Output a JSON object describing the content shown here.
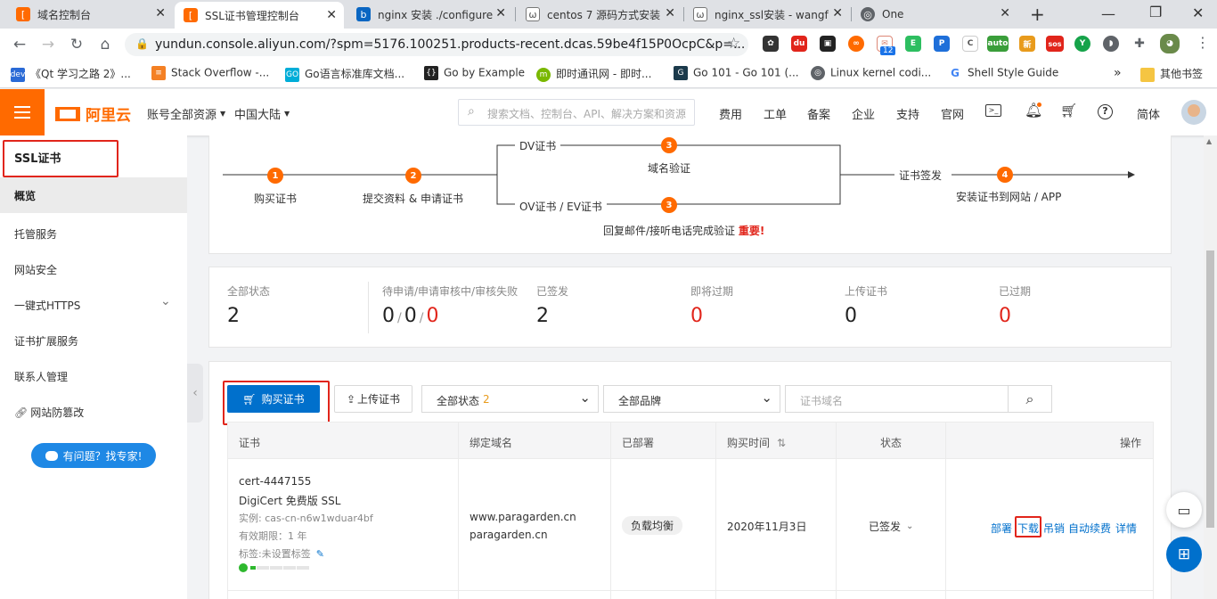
{
  "browser": {
    "tabs": [
      {
        "title": "域名控制台",
        "favicon": "aliyun-icon",
        "active": false
      },
      {
        "title": "SSL证书管理控制台",
        "favicon": "aliyun-icon",
        "active": true
      },
      {
        "title": "nginx 安装 ./configure",
        "favicon": "bing-icon",
        "active": false
      },
      {
        "title": "centos 7 源码方式安装",
        "favicon": "blog-icon",
        "active": false
      },
      {
        "title": "nginx_ssl安装 - wangf",
        "favicon": "blog-icon",
        "active": false
      },
      {
        "title": "One",
        "favicon": "globe-icon",
        "active": false
      }
    ],
    "url": "yundun.console.aliyun.com/?spm=5176.100251.products-recent.dcas.59be4f15P0OcpC&p=...",
    "extension_badges": {
      "mail": "12",
      "auto": "auto",
      "new": "新",
      "sos": "sos"
    },
    "bookmarks": [
      "《Qt 学习之路 2》...",
      "Stack Overflow -...",
      "Go语言标准库文档...",
      "Go by Example",
      "即时通讯网 - 即时...",
      "Go 101 - Go 101 (...",
      "Linux kernel codi...",
      "Shell Style Guide"
    ],
    "bookmarks_more": "»",
    "other_bookmarks": "其他书签"
  },
  "header": {
    "logo": "阿里云",
    "account_scope": "账号全部资源",
    "region": "中国大陆",
    "search_placeholder": "搜索文档、控制台、API、解决方案和资源",
    "nav": [
      "费用",
      "工单",
      "备案",
      "企业",
      "支持",
      "官网"
    ],
    "language": "简体"
  },
  "sidebar": {
    "title": "SSL证书",
    "items": [
      "概览",
      "托管服务",
      "网站安全",
      "一键式HTTPS",
      "证书扩展服务",
      "联系人管理",
      "网站防篡改"
    ],
    "help_button": "有问题？找专家!"
  },
  "flow": {
    "steps": [
      {
        "num": "1",
        "label": "购买证书"
      },
      {
        "num": "2",
        "label": "提交资料 & 申请证书"
      },
      {
        "num": "3",
        "label": "域名验证"
      },
      {
        "num": "3",
        "label": "回复邮件/接听电话完成验证"
      },
      {
        "num": "4",
        "label": "安装证书到网站 / APP"
      }
    ],
    "dv_label": "DV证书",
    "ov_label": "OV证书 / EV证书",
    "issue_label": "证书签发",
    "important": "重要!"
  },
  "stats": {
    "all": {
      "label": "全部状态",
      "value": "2"
    },
    "pending": {
      "label": "待申请/申请审核中/审核失败",
      "v1": "0",
      "v2": "0",
      "v3": "0",
      "sep": "/"
    },
    "issued": {
      "label": "已签发",
      "value": "2"
    },
    "expiring": {
      "label": "即将过期",
      "value": "0"
    },
    "uploaded": {
      "label": "上传证书",
      "value": "0"
    },
    "expired": {
      "label": "已过期",
      "value": "0"
    }
  },
  "toolbar": {
    "buy": "购买证书",
    "upload": "上传证书",
    "status_filter": "全部状态",
    "status_count": "2",
    "brand_filter": "全部品牌",
    "domain_placeholder": "证书域名"
  },
  "table": {
    "headers": [
      "证书",
      "绑定域名",
      "已部署",
      "购买时间",
      "状态",
      "操作"
    ],
    "rows": [
      {
        "name": "cert-4447155",
        "product": "DigiCert 免费版 SSL",
        "instance": "实例: cas-cn-n6w1wduar4bf",
        "validity": "有效期限：1 年",
        "tags": "标签:未设置标签",
        "domains": [
          "www.paragarden.cn",
          "paragarden.cn"
        ],
        "deployed": "负载均衡",
        "purchase_date": "2020年11月3日",
        "status": "已签发",
        "actions": [
          "部署",
          "下载",
          "吊销",
          "自动续费",
          "详情"
        ]
      }
    ]
  }
}
